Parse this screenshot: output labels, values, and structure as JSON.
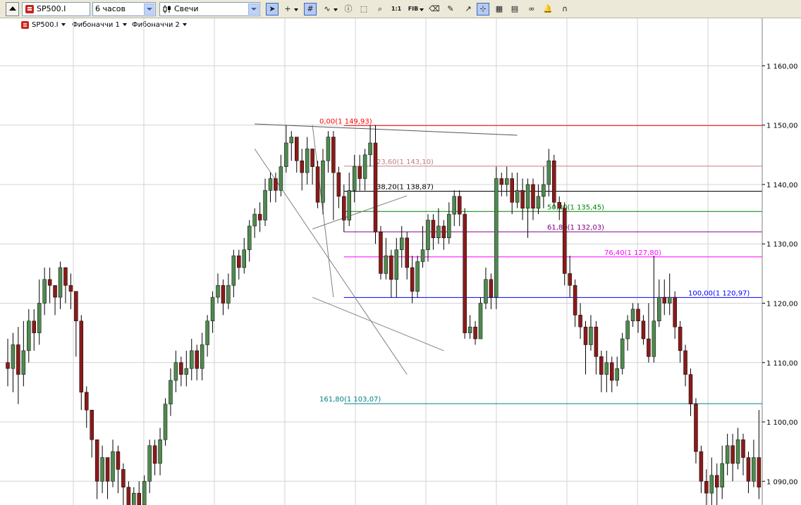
{
  "toolbar": {
    "symbol": "SP500.I",
    "timeframe": "6 часов",
    "chart_type": "Свечи",
    "tools": [
      {
        "name": "cursor-arrow-icon",
        "glyph": "➤",
        "active": true
      },
      {
        "name": "crosshair-icon",
        "glyph": "+",
        "caret": true
      },
      {
        "name": "grid-icon",
        "glyph": "#",
        "active": true
      },
      {
        "name": "indicators-icon",
        "glyph": "∿",
        "caret": true
      },
      {
        "name": "info-icon",
        "glyph": "ⓘ"
      },
      {
        "name": "zoom-region-icon",
        "glyph": "⬚"
      },
      {
        "name": "zoom-icon",
        "glyph": "⌕"
      },
      {
        "name": "scale-1to1-icon",
        "glyph": "1:1",
        "small": true
      },
      {
        "name": "fibonacci-icon",
        "glyph": "FIB",
        "small": true,
        "caret": true
      },
      {
        "name": "eraser-icon",
        "glyph": "⌫"
      },
      {
        "name": "delete-drawings-icon",
        "glyph": "✎"
      },
      {
        "name": "trend-tool-icon",
        "glyph": "↗"
      },
      {
        "name": "magnet-icon",
        "glyph": "⊹",
        "active": true
      },
      {
        "name": "templates-icon",
        "glyph": "▦"
      },
      {
        "name": "properties-icon",
        "glyph": "▤"
      },
      {
        "name": "link-icon",
        "glyph": "∞"
      },
      {
        "name": "alert-bell-icon",
        "glyph": "🔔"
      },
      {
        "name": "snap-magnet-icon",
        "glyph": "∩"
      }
    ]
  },
  "legend": {
    "symbol": "SP500.I",
    "studies": [
      "Фибоначчи 1",
      "Фибоначчи 2"
    ]
  },
  "colors": {
    "up_body": "#4f8a4f",
    "down_body": "#8b1a1a",
    "wick": "#000000",
    "grid": "#d3d3d3",
    "axis_bg": "#ffffff"
  },
  "chart_data": {
    "type": "candlestick",
    "symbol": "SP500.I",
    "timeframe": "6 часов",
    "ylim": [
      1086,
      1168
    ],
    "y_ticks": [
      1090,
      1100,
      1110,
      1120,
      1130,
      1140,
      1150,
      1160
    ],
    "y_tick_labels": [
      "1 090,00",
      "1 100,00",
      "1 110,00",
      "1 120,00",
      "1 130,00",
      "1 140,00",
      "1 150,00",
      "1 160,00"
    ],
    "fibonacci_levels": [
      {
        "label": "0,00(1 149,93)",
        "value": 1149.93,
        "color": "#ff0000"
      },
      {
        "label": "23,60(1 143,10)",
        "value": 1143.1,
        "color": "#c08080"
      },
      {
        "label": "38,20(1 138,87)",
        "value": 1138.87,
        "color": "#000000"
      },
      {
        "label": "50,00(1 135,45)",
        "value": 1135.45,
        "color": "#008000"
      },
      {
        "label": "61,80(1 132,03)",
        "value": 1132.03,
        "color": "#800080"
      },
      {
        "label": "76,40(1 127,80)",
        "value": 1127.8,
        "color": "#ff00ff"
      },
      {
        "label": "100,00(1 120,97)",
        "value": 1120.97,
        "color": "#0000ff"
      },
      {
        "label": "161,80(1 103,07)",
        "value": 1103.07,
        "color": "#008080"
      }
    ],
    "candles": [
      [
        1110,
        1109,
        1114,
        1106
      ],
      [
        1109,
        1113,
        1115,
        1105
      ],
      [
        1113,
        1108,
        1116,
        1103
      ],
      [
        1108,
        1112,
        1117,
        1106
      ],
      [
        1112,
        1117,
        1119,
        1110
      ],
      [
        1117,
        1115,
        1119,
        1112
      ],
      [
        1115,
        1120,
        1124,
        1113
      ],
      [
        1120,
        1124,
        1126,
        1118
      ],
      [
        1124,
        1123,
        1126,
        1120
      ],
      [
        1123,
        1121,
        1123,
        1118
      ],
      [
        1121,
        1126,
        1127,
        1119
      ],
      [
        1126,
        1123,
        1126,
        1120
      ],
      [
        1123,
        1122,
        1125,
        1119
      ],
      [
        1122,
        1117,
        1122,
        1111
      ],
      [
        1117,
        1105,
        1118,
        1102
      ],
      [
        1105,
        1102,
        1106,
        1099
      ],
      [
        1102,
        1097,
        1102,
        1094
      ],
      [
        1097,
        1090,
        1097,
        1087
      ],
      [
        1090,
        1094,
        1096,
        1088
      ],
      [
        1094,
        1090,
        1094,
        1087
      ],
      [
        1090,
        1095,
        1097,
        1089
      ],
      [
        1095,
        1092,
        1096,
        1088
      ],
      [
        1092,
        1089,
        1093,
        1086
      ],
      [
        1089,
        1085,
        1090,
        1082
      ],
      [
        1085,
        1088,
        1089,
        1083
      ],
      [
        1088,
        1086,
        1090,
        1083
      ],
      [
        1086,
        1090,
        1091,
        1085
      ],
      [
        1090,
        1096,
        1097,
        1088
      ],
      [
        1096,
        1093,
        1097,
        1091
      ],
      [
        1093,
        1097,
        1099,
        1091
      ],
      [
        1097,
        1103,
        1104,
        1096
      ],
      [
        1103,
        1107,
        1109,
        1101
      ],
      [
        1107,
        1110,
        1112,
        1105
      ],
      [
        1110,
        1108,
        1111,
        1106
      ],
      [
        1108,
        1109,
        1112,
        1106
      ],
      [
        1109,
        1112,
        1114,
        1107
      ],
      [
        1112,
        1109,
        1113,
        1107
      ],
      [
        1109,
        1113,
        1115,
        1107
      ],
      [
        1113,
        1117,
        1118,
        1111
      ],
      [
        1117,
        1121,
        1122,
        1115
      ],
      [
        1121,
        1123,
        1125,
        1120
      ],
      [
        1123,
        1120,
        1124,
        1118
      ],
      [
        1120,
        1123,
        1125,
        1119
      ],
      [
        1123,
        1128,
        1129,
        1121
      ],
      [
        1128,
        1126,
        1129,
        1124
      ],
      [
        1126,
        1129,
        1131,
        1125
      ],
      [
        1129,
        1133,
        1134,
        1127
      ],
      [
        1133,
        1135,
        1136,
        1131
      ],
      [
        1135,
        1134,
        1137,
        1132
      ],
      [
        1134,
        1139,
        1141,
        1133
      ],
      [
        1139,
        1141,
        1142,
        1137
      ],
      [
        1141,
        1139,
        1142,
        1137
      ],
      [
        1139,
        1143,
        1145,
        1138
      ],
      [
        1143,
        1147,
        1150,
        1142
      ],
      [
        1147,
        1148,
        1149,
        1144
      ],
      [
        1148,
        1144,
        1148,
        1142
      ],
      [
        1144,
        1142,
        1146,
        1139
      ],
      [
        1142,
        1146,
        1148,
        1140
      ],
      [
        1146,
        1143,
        1146,
        1140
      ],
      [
        1143,
        1137,
        1144,
        1136
      ],
      [
        1137,
        1144,
        1146,
        1135
      ],
      [
        1144,
        1148,
        1149,
        1142
      ],
      [
        1148,
        1142,
        1149,
        1134
      ],
      [
        1142,
        1138,
        1143,
        1136
      ],
      [
        1138,
        1134,
        1140,
        1132
      ],
      [
        1134,
        1139,
        1142,
        1133
      ],
      [
        1139,
        1143,
        1145,
        1137
      ],
      [
        1143,
        1141,
        1145,
        1139
      ],
      [
        1141,
        1145,
        1146,
        1139
      ],
      [
        1145,
        1147,
        1150,
        1143
      ],
      [
        1147,
        1132,
        1150,
        1130
      ],
      [
        1132,
        1125,
        1133,
        1124
      ],
      [
        1125,
        1128,
        1131,
        1124
      ],
      [
        1128,
        1124,
        1129,
        1121
      ],
      [
        1124,
        1129,
        1131,
        1121
      ],
      [
        1129,
        1131,
        1133,
        1126
      ],
      [
        1131,
        1126,
        1132,
        1124
      ],
      [
        1126,
        1122,
        1128,
        1120
      ],
      [
        1122,
        1127,
        1128,
        1121
      ],
      [
        1127,
        1129,
        1133,
        1126
      ],
      [
        1129,
        1134,
        1135,
        1127
      ],
      [
        1134,
        1131,
        1135,
        1129
      ],
      [
        1131,
        1133,
        1136,
        1130
      ],
      [
        1133,
        1131,
        1134,
        1129
      ],
      [
        1131,
        1135,
        1137,
        1130
      ],
      [
        1135,
        1138,
        1139,
        1133
      ],
      [
        1138,
        1135,
        1139,
        1133
      ],
      [
        1135,
        1115,
        1136,
        1114
      ],
      [
        1115,
        1116,
        1118,
        1114
      ],
      [
        1116,
        1114,
        1117,
        1113
      ],
      [
        1114,
        1120,
        1121,
        1114
      ],
      [
        1120,
        1124,
        1126,
        1119
      ],
      [
        1124,
        1121,
        1125,
        1119
      ],
      [
        1121,
        1141,
        1143,
        1119
      ],
      [
        1141,
        1140,
        1142,
        1138
      ],
      [
        1140,
        1141,
        1143,
        1138
      ],
      [
        1141,
        1137,
        1142,
        1135
      ],
      [
        1137,
        1139,
        1142,
        1136
      ],
      [
        1139,
        1136,
        1141,
        1134
      ],
      [
        1136,
        1140,
        1141,
        1131
      ],
      [
        1140,
        1136,
        1141,
        1134
      ],
      [
        1136,
        1138,
        1140,
        1135
      ],
      [
        1138,
        1140,
        1143,
        1136
      ],
      [
        1140,
        1144,
        1146,
        1138
      ],
      [
        1144,
        1137,
        1145,
        1136
      ],
      [
        1137,
        1136,
        1138,
        1134
      ],
      [
        1136,
        1125,
        1137,
        1123
      ],
      [
        1125,
        1123,
        1128,
        1121
      ],
      [
        1123,
        1118,
        1124,
        1116
      ],
      [
        1118,
        1116,
        1120,
        1114
      ],
      [
        1116,
        1113,
        1117,
        1108
      ],
      [
        1113,
        1116,
        1118,
        1112
      ],
      [
        1116,
        1111,
        1117,
        1108
      ],
      [
        1111,
        1108,
        1112,
        1105
      ],
      [
        1108,
        1110,
        1112,
        1105
      ],
      [
        1110,
        1107,
        1111,
        1105
      ],
      [
        1107,
        1109,
        1111,
        1106
      ],
      [
        1109,
        1114,
        1115,
        1108
      ],
      [
        1114,
        1117,
        1118,
        1112
      ],
      [
        1117,
        1119,
        1120,
        1116
      ],
      [
        1119,
        1117,
        1120,
        1115
      ],
      [
        1117,
        1114,
        1118,
        1113
      ],
      [
        1114,
        1111,
        1120,
        1110
      ],
      [
        1111,
        1117,
        1128,
        1110
      ],
      [
        1117,
        1121,
        1124,
        1116
      ],
      [
        1121,
        1120,
        1124,
        1118
      ],
      [
        1120,
        1121,
        1125,
        1118
      ],
      [
        1121,
        1116,
        1122,
        1114
      ],
      [
        1116,
        1112,
        1117,
        1110
      ],
      [
        1112,
        1108,
        1113,
        1106
      ],
      [
        1108,
        1103,
        1109,
        1101
      ],
      [
        1103,
        1095,
        1104,
        1093
      ],
      [
        1095,
        1090,
        1096,
        1088
      ],
      [
        1090,
        1088,
        1092,
        1085
      ],
      [
        1088,
        1091,
        1094,
        1086
      ],
      [
        1091,
        1089,
        1093,
        1086
      ],
      [
        1089,
        1093,
        1096,
        1087
      ],
      [
        1093,
        1096,
        1098,
        1091
      ],
      [
        1096,
        1093,
        1098,
        1090
      ],
      [
        1093,
        1097,
        1099,
        1092
      ],
      [
        1097,
        1094,
        1098,
        1091
      ],
      [
        1094,
        1090,
        1095,
        1088
      ],
      [
        1090,
        1094,
        1097,
        1089
      ],
      [
        1094,
        1089,
        1102,
        1087
      ],
      [
        1089,
        1086,
        1092,
        1084
      ]
    ],
    "trendlines": [
      {
        "from": [
          47,
          1150.2
        ],
        "to": [
          97,
          1148.3
        ],
        "color": "#555555"
      },
      {
        "from": [
          47,
          1146
        ],
        "to": [
          76,
          1108
        ],
        "color": "#808080"
      },
      {
        "from": [
          58,
          1121
        ],
        "to": [
          83,
          1112
        ],
        "color": "#808080"
      },
      {
        "from": [
          58,
          1132.5
        ],
        "to": [
          76,
          1138.1
        ],
        "color": "#808080"
      },
      {
        "from": [
          58,
          1150
        ],
        "to": [
          62,
          1121
        ],
        "color": "#808080"
      }
    ]
  }
}
